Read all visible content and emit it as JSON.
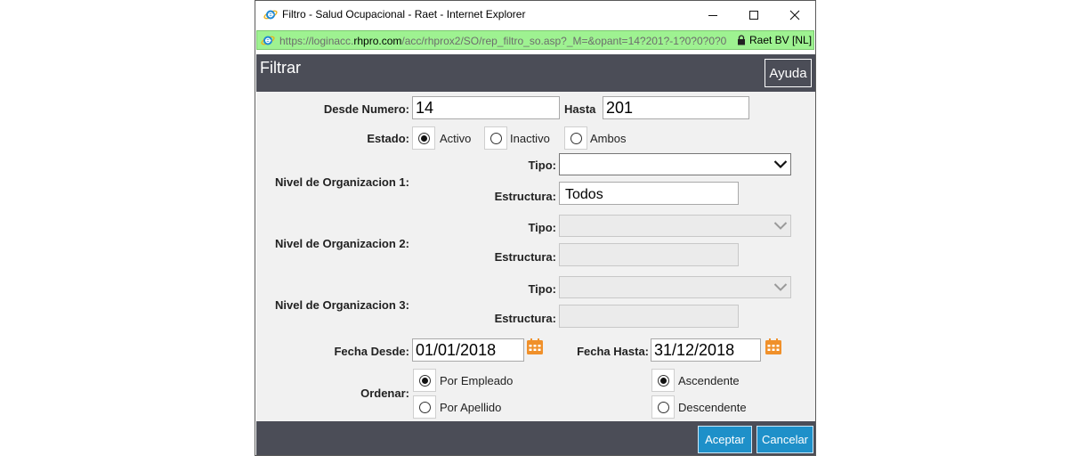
{
  "window": {
    "title": "Filtro - Salud Ocupacional - Raet - Internet Explorer",
    "url_prefix": "https://loginacc.",
    "url_host": "rhpro.com",
    "url_path": "/acc/rhprox2/SO/rep_filtro_so.asp?_M=&opant=14?201?-1?0?0?0?0",
    "site_identity": "Raet BV [NL]"
  },
  "header": {
    "title": "Filtrar",
    "help_label": "Ayuda"
  },
  "form": {
    "desde_numero_label": "Desde Numero:",
    "desde_numero_value": "14",
    "hasta_label": "Hasta",
    "hasta_value": "201",
    "estado_label": "Estado:",
    "estado_options": [
      {
        "label": "Activo",
        "selected": true
      },
      {
        "label": "Inactivo",
        "selected": false
      },
      {
        "label": "Ambos",
        "selected": false
      }
    ],
    "org_levels": [
      {
        "label": "Nivel de Organizacion 1:",
        "tipo_label": "Tipo:",
        "tipo_value": "",
        "estructura_label": "Estructura:",
        "estructura_value": "Todos",
        "enabled": true
      },
      {
        "label": "Nivel de Organizacion 2:",
        "tipo_label": "Tipo:",
        "tipo_value": "",
        "estructura_label": "Estructura:",
        "estructura_value": "",
        "enabled": false
      },
      {
        "label": "Nivel de Organizacion 3:",
        "tipo_label": "Tipo:",
        "tipo_value": "",
        "estructura_label": "Estructura:",
        "estructura_value": "",
        "enabled": false
      }
    ],
    "fecha_desde_label": "Fecha Desde:",
    "fecha_desde_value": "01/01/2018",
    "fecha_hasta_label": "Fecha Hasta:",
    "fecha_hasta_value": "31/12/2018",
    "ordenar_label": "Ordenar:",
    "ordenar_options": [
      {
        "label": "Por Empleado",
        "selected": true
      },
      {
        "label": "Por Apellido",
        "selected": false
      }
    ],
    "direction_options": [
      {
        "label": "Ascendente",
        "selected": true
      },
      {
        "label": "Descendente",
        "selected": false
      }
    ]
  },
  "footer": {
    "accept_label": "Aceptar",
    "cancel_label": "Cancelar"
  },
  "colors": {
    "header_bg": "#4b4d57",
    "address_bar_bg": "#9ef291",
    "button_bg": "#1e90c9",
    "calendar_icon": "#f0902a"
  }
}
